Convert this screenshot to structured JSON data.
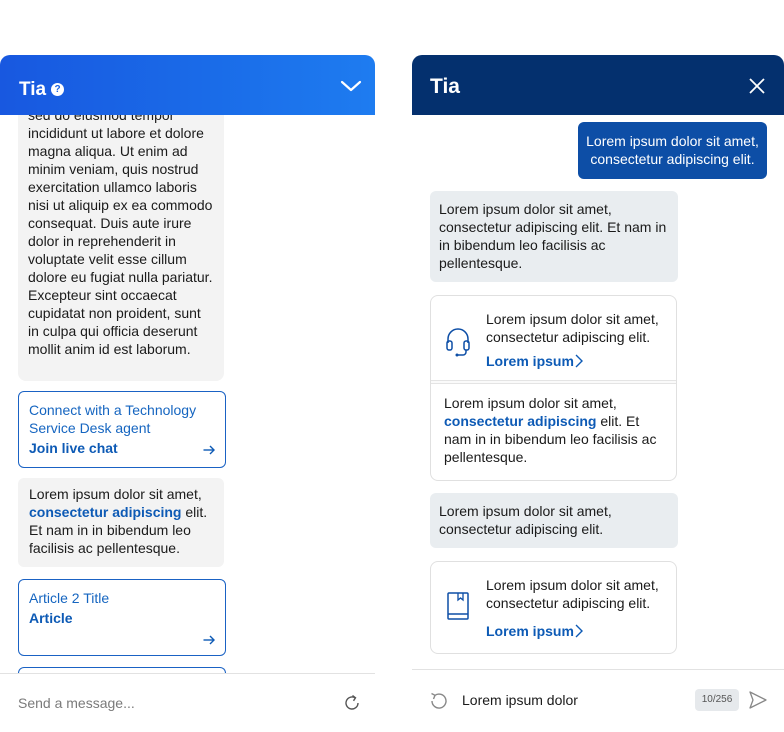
{
  "left": {
    "title": "Tia",
    "help_icon": "?",
    "bubble1_text": "sed do eiusmod tempor incididunt ut labore et dolore magna aliqua. Ut enim ad minim veniam, quis nostrud exercitation ullamco laboris nisi ut aliquip ex ea commodo consequat. Duis aute irure dolor in reprehenderit in voluptate velit esse cillum dolore eu fugiat nulla pariatur. Excepteur sint occaecat cupidatat non proident, sunt in culpa qui officia deserunt mollit anim id est laborum.",
    "card1": {
      "text": "Connect with a Technology Service Desk agent",
      "link": "Join live chat"
    },
    "bubble2": {
      "pre": "Lorem ipsum dolor sit amet, ",
      "bold": "consectetur adipiscing",
      "post": " elit. Et nam in in bibendum leo facilisis ac pellentesque."
    },
    "card2": {
      "text": "Article 2 Title",
      "link": "Article"
    },
    "input_placeholder": "Send a message..."
  },
  "right": {
    "title": "Tia",
    "user_message": "Lorem ipsum dolor sit amet, consectetur adipiscing elit.",
    "bot1": "Lorem ipsum dolor sit amet, consectetur adipiscing elit. Et nam in in bibendum leo facilisis ac pellentesque.",
    "card1": {
      "text": "Lorem ipsum dolor sit amet, consectetur adipiscing elit.",
      "link": "Lorem ipsum",
      "icon": "headset-icon",
      "body_pre": "Lorem ipsum dolor sit amet, ",
      "body_bold": "consectetur adipiscing",
      "body_post": " elit. Et nam in in bibendum leo facilisis ac pellentesque."
    },
    "bot2": "Lorem ipsum dolor sit amet, consectetur adipiscing elit.",
    "card2": {
      "text": "Lorem ipsum dolor sit amet, consectetur adipiscing elit.",
      "link": "Lorem ipsum",
      "icon": "book-icon"
    },
    "input_value": "Lorem ipsum dolor",
    "char_count": "10/256"
  },
  "colors": {
    "left_header_start": "#1858e0",
    "left_header_end": "#1e7cf0",
    "right_header": "#04306e",
    "user_bubble": "#0d4ea6",
    "link_blue": "#0d5ab5",
    "bot_bubble": "#e9edf0"
  }
}
